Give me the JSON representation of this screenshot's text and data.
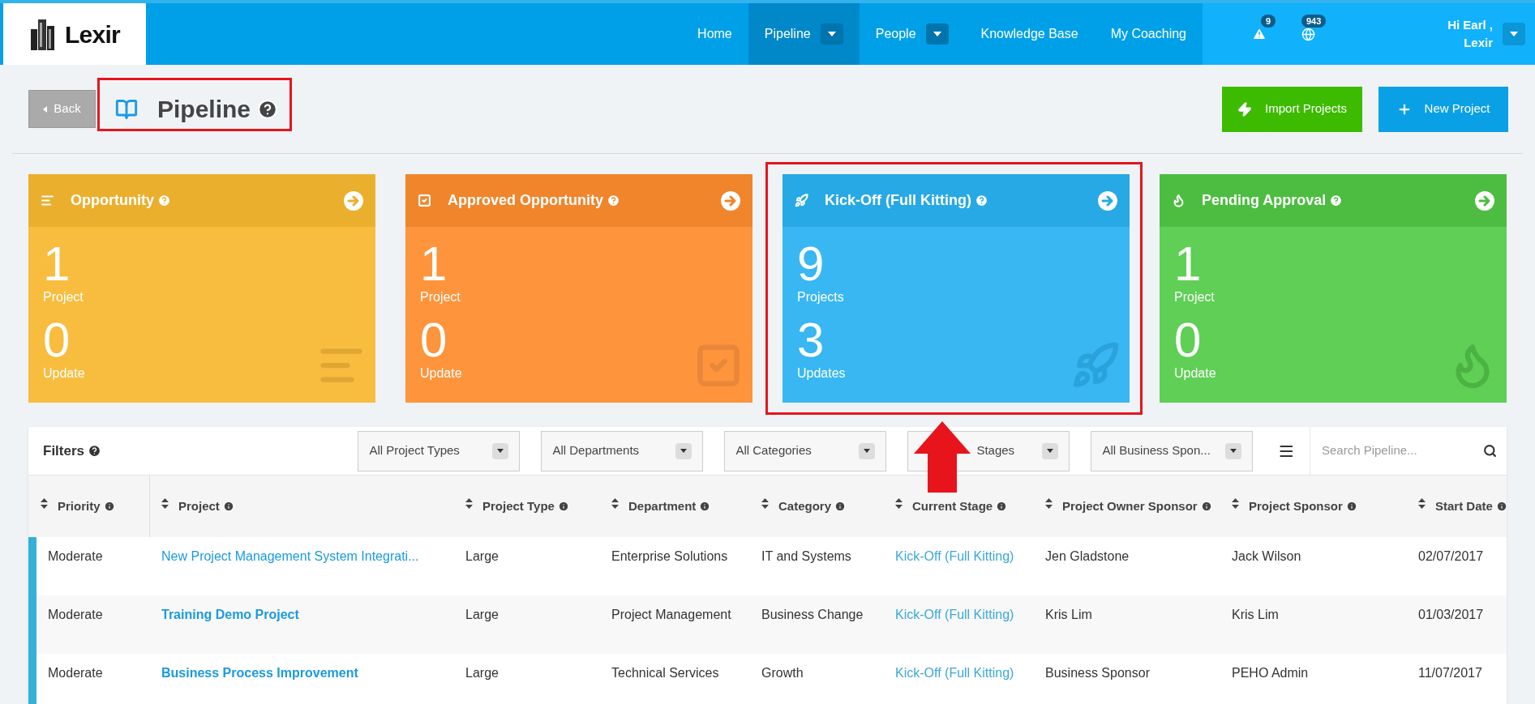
{
  "brand": {
    "name": "Lexir"
  },
  "nav": {
    "items": [
      {
        "label": "Home",
        "selected": false,
        "dropdown": false
      },
      {
        "label": "Pipeline",
        "selected": true,
        "dropdown": true
      },
      {
        "label": "People",
        "selected": false,
        "dropdown": true
      },
      {
        "label": "Knowledge Base",
        "selected": false,
        "dropdown": false
      },
      {
        "label": "My Coaching",
        "selected": false,
        "dropdown": false
      }
    ],
    "alerts_count": "9",
    "notifications_count": "943",
    "greeting": "Hi Earl ,",
    "user": "Lexir"
  },
  "header": {
    "back": "Back",
    "title": "Pipeline",
    "actions": [
      {
        "kind": "import",
        "label": "Import Projects"
      },
      {
        "kind": "new",
        "label": "New Project"
      }
    ]
  },
  "stages": [
    {
      "kind": "opportunity",
      "title": "Opportunity",
      "projects_count": "1",
      "projects_label": "Project",
      "updates_count": "0",
      "updates_label": "Update"
    },
    {
      "kind": "approved",
      "title": "Approved Opportunity",
      "projects_count": "1",
      "projects_label": "Project",
      "updates_count": "0",
      "updates_label": "Update"
    },
    {
      "kind": "kickoff",
      "title": "Kick-Off (Full Kitting)",
      "projects_count": "9",
      "projects_label": "Projects",
      "updates_count": "3",
      "updates_label": "Updates"
    },
    {
      "kind": "pending",
      "title": "Pending Approval",
      "projects_count": "1",
      "projects_label": "Project",
      "updates_count": "0",
      "updates_label": "Update"
    }
  ],
  "filters": {
    "label": "Filters",
    "selects": [
      "All Project Types",
      "All Departments",
      "All Categories",
      "Stages",
      "All Business Spon..."
    ],
    "search": {
      "placeholder": "Search Pipeline..."
    }
  },
  "table": {
    "columns": [
      {
        "label": "Priority"
      },
      {
        "label": "Project"
      },
      {
        "label": "Project Type"
      },
      {
        "label": "Department"
      },
      {
        "label": "Category"
      },
      {
        "label": "Current Stage"
      },
      {
        "label": "Project Owner Sponsor"
      },
      {
        "label": "Project Sponsor"
      },
      {
        "label": "Start Date"
      }
    ],
    "rows": [
      {
        "bold": false,
        "cells": [
          "Moderate",
          "New Project Management System Integrati...",
          "Large",
          "Enterprise Solutions",
          "IT and Systems",
          "Kick-Off (Full Kitting)",
          "Jen Gladstone",
          "Jack Wilson",
          "02/07/2017"
        ]
      },
      {
        "bold": true,
        "cells": [
          "Moderate",
          "Training Demo Project",
          "Large",
          "Project Management",
          "Business Change",
          "Kick-Off (Full Kitting)",
          "Kris Lim",
          "Kris Lim",
          "01/03/2017"
        ]
      },
      {
        "bold": true,
        "cells": [
          "Moderate",
          "Business Process Improvement",
          "Large",
          "Technical Services",
          "Growth",
          "Kick-Off (Full Kitting)",
          "Business Sponsor",
          "PEHO Admin",
          "11/07/2017"
        ]
      }
    ]
  }
}
